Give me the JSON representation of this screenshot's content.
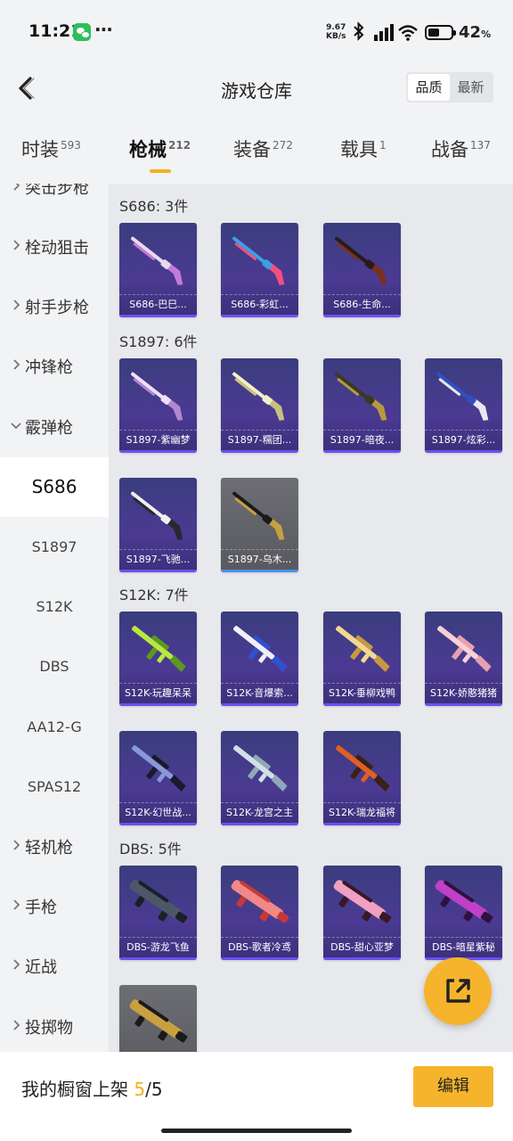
{
  "status_bar": {
    "time": "11:21",
    "dots": "···",
    "net_speed_value": "9.67",
    "net_speed_unit": "KB/s",
    "battery_percent": "42",
    "battery_suffix": "%"
  },
  "header": {
    "title": "游戏仓库",
    "sort_options": [
      "品质",
      "最新"
    ],
    "active_sort": "品质"
  },
  "categories": [
    {
      "label": "时装",
      "count": "593"
    },
    {
      "label": "枪械",
      "count": "212"
    },
    {
      "label": "装备",
      "count": "272"
    },
    {
      "label": "载具",
      "count": "1"
    },
    {
      "label": "战备",
      "count": "137"
    }
  ],
  "active_category": "枪械",
  "sidebar": {
    "items": [
      {
        "label": "突击步枪",
        "type": "group"
      },
      {
        "label": "栓动狙击",
        "type": "group"
      },
      {
        "label": "射手步枪",
        "type": "group"
      },
      {
        "label": "冲锋枪",
        "type": "group"
      },
      {
        "label": "霰弹枪",
        "type": "group",
        "expanded": true
      },
      {
        "label": "S686",
        "type": "sub",
        "selected": true
      },
      {
        "label": "S1897",
        "type": "sub"
      },
      {
        "label": "S12K",
        "type": "sub"
      },
      {
        "label": "DBS",
        "type": "sub"
      },
      {
        "label": "AA12-G",
        "type": "sub"
      },
      {
        "label": "SPAS12",
        "type": "sub"
      },
      {
        "label": "轻机枪",
        "type": "group"
      },
      {
        "label": "手枪",
        "type": "group"
      },
      {
        "label": "近战",
        "type": "group"
      },
      {
        "label": "投掷物",
        "type": "group"
      }
    ]
  },
  "sections": [
    {
      "title": "S686: 3件",
      "items": [
        {
          "label": "S686-巴巳...",
          "gun": "shotgun",
          "colors": [
            "#e8d9f0",
            "#c47ad8"
          ]
        },
        {
          "label": "S686-彩虹...",
          "gun": "shotgun",
          "colors": [
            "#3aa0e8",
            "#f05080"
          ]
        },
        {
          "label": "S686-生命...",
          "gun": "shotgun",
          "colors": [
            "#2a1a1a",
            "#7a3020"
          ]
        }
      ]
    },
    {
      "title": "S1897: 6件",
      "items": [
        {
          "label": "S1897-紫幽梦",
          "gun": "pump",
          "colors": [
            "#f0e0f8",
            "#b088d0"
          ]
        },
        {
          "label": "S1897-糯团...",
          "gun": "pump",
          "colors": [
            "#f0f0c8",
            "#c8c080"
          ]
        },
        {
          "label": "S1897-暗夜...",
          "gun": "pump",
          "colors": [
            "#3a3a20",
            "#b89a40"
          ]
        },
        {
          "label": "S1897-炫彩...",
          "gun": "pump",
          "colors": [
            "#3050c0",
            "#e8e8f0"
          ]
        },
        {
          "label": "S1897-飞驰...",
          "gun": "pump",
          "colors": [
            "#f0f0f0",
            "#282830"
          ]
        },
        {
          "label": "S1897-乌木...",
          "gun": "pump",
          "colors": [
            "#1a1a1a",
            "#c8a040"
          ],
          "gray": true
        }
      ]
    },
    {
      "title": "S12K: 7件",
      "items": [
        {
          "label": "S12K-玩趣呆呆",
          "gun": "rifle",
          "colors": [
            "#b8e840",
            "#5a9a20"
          ]
        },
        {
          "label": "S12K-音爆索...",
          "gun": "rifle",
          "colors": [
            "#f0f0f8",
            "#3050d0"
          ]
        },
        {
          "label": "S12K-垂柳戏鸭",
          "gun": "rifle",
          "colors": [
            "#f0d890",
            "#c89840"
          ]
        },
        {
          "label": "S12K-娇憨猪猪",
          "gun": "rifle",
          "colors": [
            "#f8d0d8",
            "#e8a0b0"
          ]
        },
        {
          "label": "S12K-幻世战...",
          "gun": "rifle",
          "colors": [
            "#8898d8",
            "#1a1a28"
          ]
        },
        {
          "label": "S12K-龙宫之主",
          "gun": "rifle",
          "colors": [
            "#d0e0e8",
            "#90a8b8"
          ]
        },
        {
          "label": "S12K-瑞龙福将",
          "gun": "rifle",
          "colors": [
            "#e06020",
            "#3a2018"
          ]
        }
      ]
    },
    {
      "title": "DBS: 5件",
      "items": [
        {
          "label": "DBS-游龙飞鱼",
          "gun": "bullpup",
          "colors": [
            "#4a5868",
            "#1a2028"
          ]
        },
        {
          "label": "DBS-歌者冷鸢",
          "gun": "bullpup",
          "colors": [
            "#f08888",
            "#c83838"
          ]
        },
        {
          "label": "DBS-甜心亚梦",
          "gun": "bullpup",
          "colors": [
            "#f0a0c0",
            "#381828"
          ]
        },
        {
          "label": "DBS-暗星紫秘",
          "gun": "bullpup",
          "colors": [
            "#c040c8",
            "#301040"
          ]
        },
        {
          "label": "",
          "gun": "bullpup",
          "colors": [
            "#c8a040",
            "#1a1a1a"
          ],
          "gray": true
        }
      ]
    }
  ],
  "bottom_bar": {
    "shelf_label": "我的橱窗上架",
    "shelf_used": "5",
    "shelf_total": "/5",
    "edit_label": "编辑"
  },
  "icons": {
    "back": "back-chevron-icon",
    "share": "share-external-icon",
    "wechat": "wechat-icon",
    "bluetooth": "bluetooth-icon",
    "signal": "signal-icon",
    "wifi": "wifi-icon",
    "battery": "battery-icon"
  },
  "accent_color": "#f5b42b"
}
